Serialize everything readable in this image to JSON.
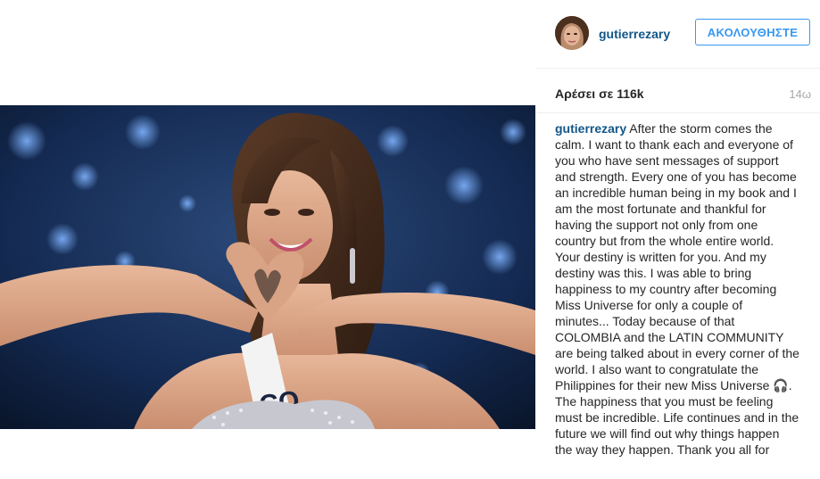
{
  "post": {
    "username": "gutierrezary",
    "follow_label": "ΑΚΟΛΟΥΘΗΣΤΕ",
    "likes_text": "Αρέσει σε 116k",
    "time_ago": "14ω",
    "caption_username": "gutierrezary",
    "caption_text": "After the storm comes the calm. I want to thank each and everyone of you who have sent messages of support and strength. Every one of you has become an incredible human being in my book and I am the most fortunate and thankful for having the support not only from one country but from the whole entire world. Your destiny is written for you. And my destiny was this. I was able to bring happiness to my country after becoming Miss Universe for only a couple of minutes... Today because of that COLOMBIA and the LATIN COMMUNITY are being talked about in every corner of the world. I also want to congratulate the Philippines for their new Miss Universe 🎧. The happiness that you must be feeling must be incredible. Life continues and in the future we will find out why things happen the way they happen. Thank you all for",
    "photo_sash_text": "CO"
  },
  "icons": {
    "avatar": "profile-avatar",
    "photo": "post-photo"
  }
}
